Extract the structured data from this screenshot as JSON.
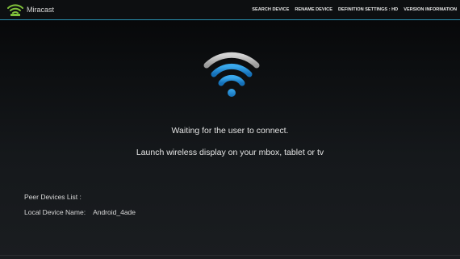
{
  "app": {
    "title": "Miracast"
  },
  "menu": {
    "items": [
      {
        "label": "SEARCH DEVICE"
      },
      {
        "label": "RENAME DEVICE"
      },
      {
        "label": "DEFINITION SETTINGS : HD"
      },
      {
        "label": "VERSION INFORMATION"
      }
    ]
  },
  "main": {
    "icon": "wifi-icon",
    "status_text": "Waiting for the user to connect.",
    "instruction_text": "Launch wireless display on your mbox, tablet or tv"
  },
  "info": {
    "peer_devices_label": "Peer Devices List :",
    "local_device_label": "Local Device Name:",
    "local_device_value": "Android_4ade"
  },
  "colors": {
    "accent": "#2a8fb0",
    "wifi_blue": "#1e8fd8",
    "wifi_gray": "#b8b8b8",
    "logo_green": "#7fc03a"
  }
}
